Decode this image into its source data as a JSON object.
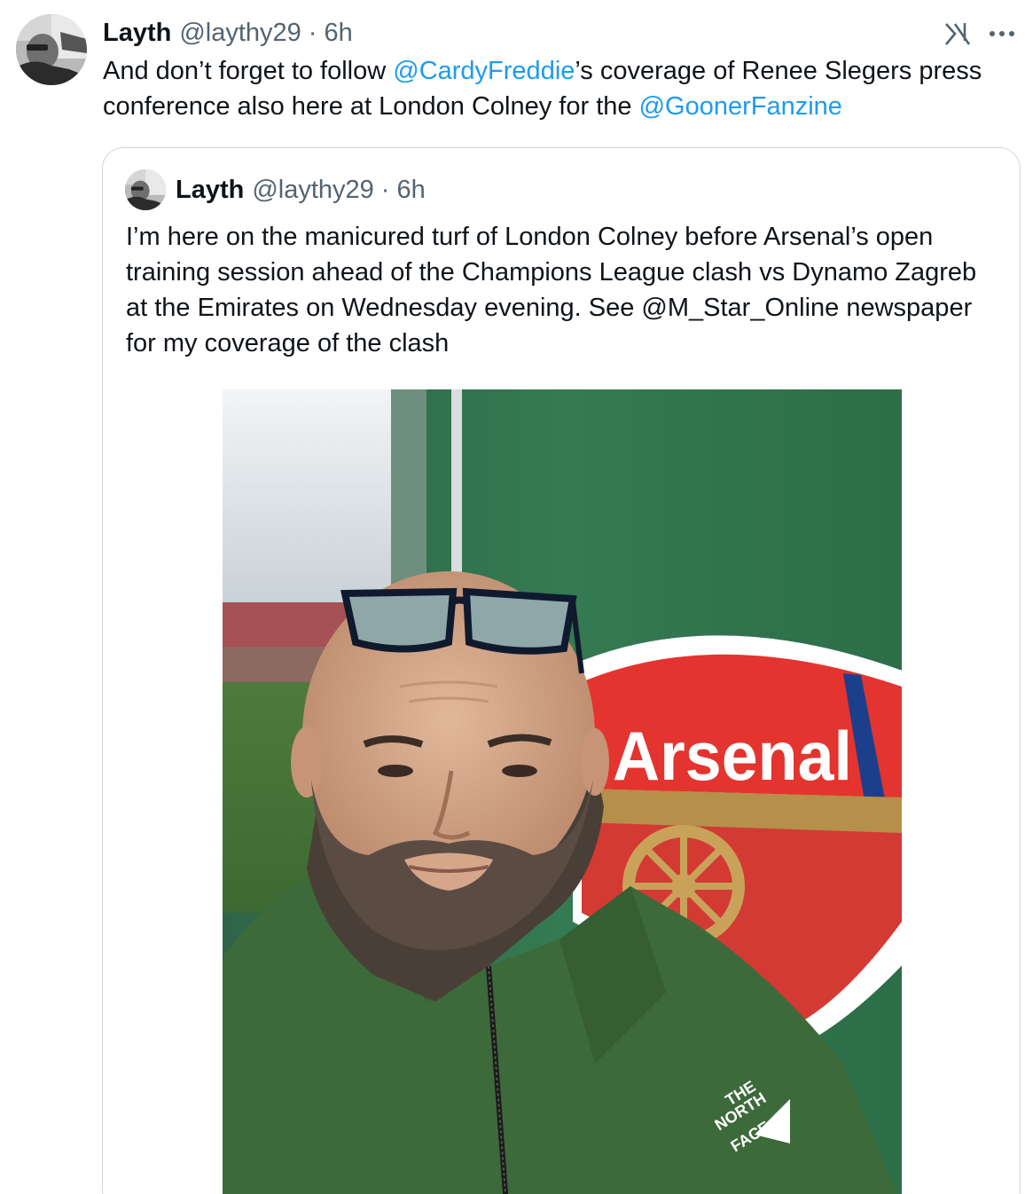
{
  "tweet": {
    "author_name": "Layth",
    "author_handle": "@laythy29",
    "separator": "·",
    "time": "6h",
    "text_parts": [
      {
        "type": "text",
        "value": "And don’t forget to follow "
      },
      {
        "type": "mention",
        "value": "@CardyFreddie"
      },
      {
        "type": "text",
        "value": "’s coverage of Renee Slegers press conference also here at London Colney for the "
      },
      {
        "type": "mention",
        "value": "@GoonerFanzine"
      }
    ],
    "icons": {
      "grok": "grok-icon",
      "more": "more-icon",
      "avatar": "avatar-photo"
    }
  },
  "quoted_tweet": {
    "author_name": "Layth",
    "author_handle": "@laythy29",
    "separator": "·",
    "time": "6h",
    "text": "I’m here on the manicured turf of London Colney before Arsenal’s open training session ahead of the Champions League clash vs Dynamo Zagreb at the Emirates on Wednesday evening. See @M_Star_Online newspaper for my coverage of the clash",
    "image": {
      "crest_text": "Arsenal",
      "jacket_logo": [
        "THE",
        "NORTH",
        "FACE"
      ]
    }
  },
  "colors": {
    "text": "#0f1419",
    "secondary": "#536471",
    "link": "#1d9bf0",
    "border": "#cfd9de"
  }
}
